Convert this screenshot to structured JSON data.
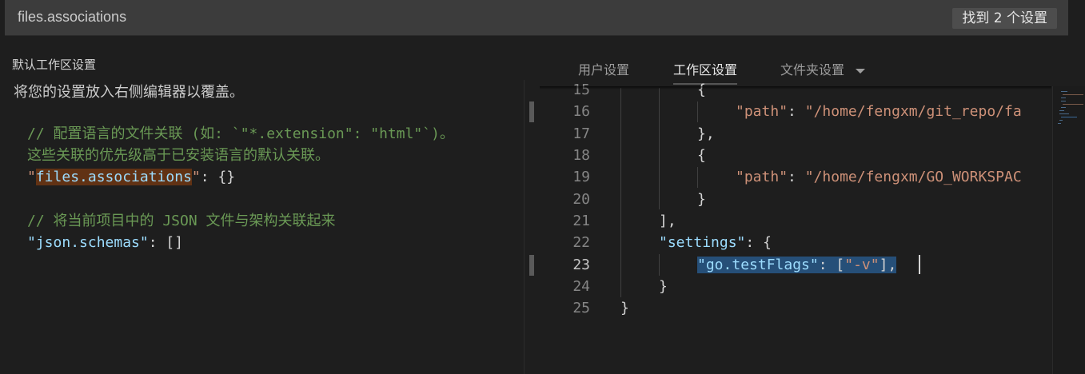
{
  "search": {
    "value": "files.associations",
    "result_badge": "找到 2 个设置"
  },
  "left": {
    "title": "默认工作区设置",
    "hint": "将您的设置放入右侧编辑器以覆盖。",
    "comment1a": "// 配置语言的文件关联 (如: `\"*.extension\": \"html\"`)。",
    "comment1b": "这些关联的优先级高于已安装语言的默认关联。",
    "setting1_key": "files.associations",
    "setting1_value": "{}",
    "comment2": "// 将当前项目中的 JSON 文件与架构关联起来",
    "setting2_key": "json.schemas",
    "setting2_value": "[]"
  },
  "tabs": [
    {
      "label": "用户设置",
      "active": false
    },
    {
      "label": "工作区设置",
      "active": true
    },
    {
      "label": "文件夹设置",
      "active": false
    }
  ],
  "editor": {
    "line_numbers": [
      "15",
      "16",
      "17",
      "18",
      "19",
      "20",
      "21",
      "22",
      "23",
      "24",
      "25"
    ],
    "current_line": "23",
    "path_key": "path",
    "path1": "/home/fengxm/git_repo/fa",
    "path2": "/home/fengxm/GO_WORKSPAC",
    "settings_key": "settings",
    "testflags_key": "go.testFlags",
    "testflags_value": "-v"
  }
}
